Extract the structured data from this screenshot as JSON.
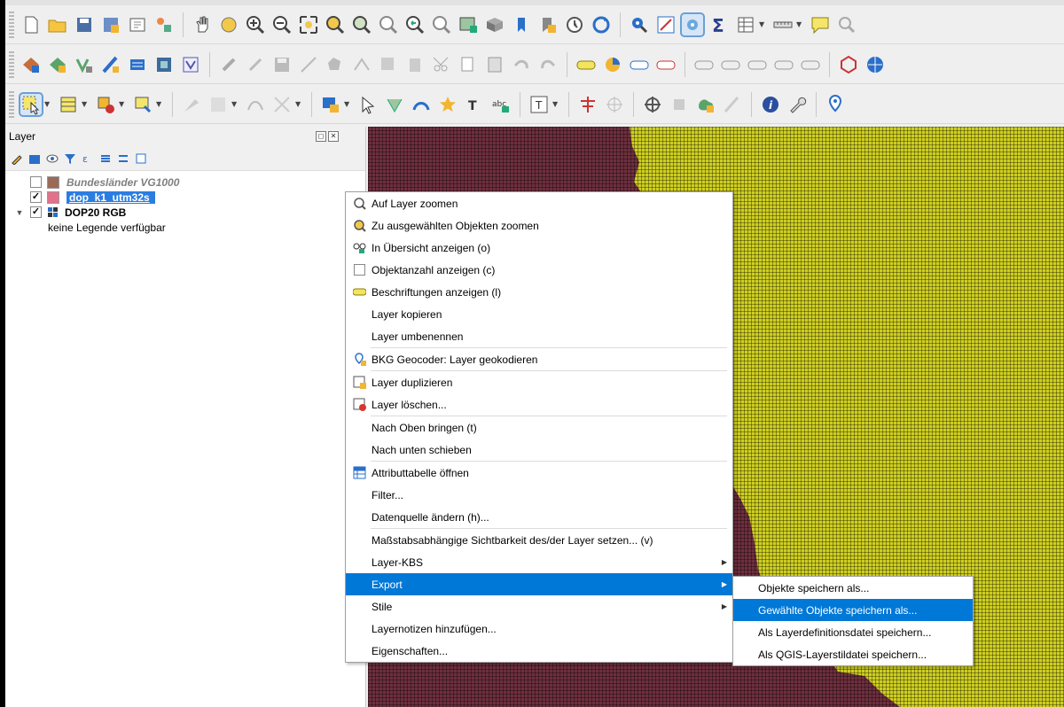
{
  "layer_panel": {
    "title": "Layer",
    "controls": [
      "◻",
      "✕"
    ],
    "layers": [
      {
        "name": "Bundesländer VG1000",
        "checked": false,
        "swatch": "#9b6b57"
      },
      {
        "name": "dop_k1_utm32s",
        "checked": true,
        "swatch": "#e3718a"
      },
      {
        "name": "DOP20 RGB",
        "checked": true
      },
      {
        "note": "keine Legende verfügbar"
      }
    ]
  },
  "map": {
    "colors": {
      "raster_yellow": "#cfcf21",
      "raster_maroon": "#6e2f3e"
    }
  },
  "context_menu": {
    "items": [
      {
        "label": "Auf Layer zoomen",
        "icon": "zoom-to-layer-icon"
      },
      {
        "label": "Zu ausgewählten Objekten zoomen",
        "icon": "zoom-to-selection-icon"
      },
      {
        "label": "In Übersicht anzeigen (o)",
        "icon": "show-in-overview-icon"
      },
      {
        "label": "Objektanzahl anzeigen (c)",
        "icon": "checkbox-icon"
      },
      {
        "label": "Beschriftungen anzeigen (l)",
        "icon": "labels-icon"
      },
      {
        "label": "Layer kopieren"
      },
      {
        "label": "Layer umbenennen"
      },
      {
        "label": "BKG Geocoder: Layer geokodieren",
        "icon": "geocoder-icon"
      },
      {
        "label": "Layer duplizieren",
        "icon": "duplicate-icon"
      },
      {
        "label": "Layer löschen...",
        "icon": "delete-layer-icon"
      },
      {
        "label": "Nach Oben bringen (t)"
      },
      {
        "label": "Nach unten schieben"
      },
      {
        "label": "Attributtabelle öffnen",
        "icon": "attribute-table-icon"
      },
      {
        "label": "Filter..."
      },
      {
        "label": "Datenquelle ändern (h)..."
      },
      {
        "label": "Maßstabsabhängige Sichtbarkeit des/der Layer setzen... (v)"
      },
      {
        "label": "Layer-KBS"
      },
      {
        "label": "Export"
      },
      {
        "label": "Stile"
      },
      {
        "label": "Layernotizen hinzufügen..."
      },
      {
        "label": "Eigenschaften..."
      }
    ]
  },
  "export_submenu": {
    "items": [
      {
        "label": "Objekte speichern als..."
      },
      {
        "label": "Gewählte Objekte speichern als..."
      },
      {
        "label": "Als Layerdefinitionsdatei speichern..."
      },
      {
        "label": "Als QGIS-Layerstildatei speichern..."
      }
    ]
  },
  "colors": {
    "highlight": "#0078d7",
    "selection": "#2b7de0"
  }
}
